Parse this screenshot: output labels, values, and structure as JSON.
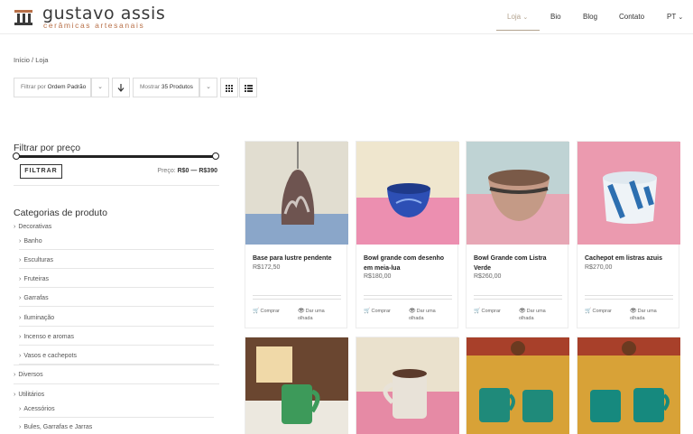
{
  "header": {
    "logo_title": "gustavo assis",
    "logo_subtitle": "cerâmicas artesanais",
    "nav": [
      {
        "label": "Loja",
        "active": true
      },
      {
        "label": "Bio"
      },
      {
        "label": "Blog"
      },
      {
        "label": "Contato"
      },
      {
        "label": "PT"
      }
    ],
    "nav_chevron": "⌄"
  },
  "breadcrumb": {
    "home": "Início",
    "separator": "/",
    "current": "Loja"
  },
  "toolbar": {
    "sort_prefix": "Filtrar por",
    "sort_value": "Ordem Padrão",
    "show_prefix": "Mostrar",
    "show_value": "35 Produtos"
  },
  "sidebar": {
    "price_heading": "Filtrar por preço",
    "filter_button": "FILTRAR",
    "price_label": "Preço:",
    "price_min": "R$0",
    "price_dash": "—",
    "price_max": "R$390",
    "categories_heading": "Categorias de produto",
    "categories": [
      {
        "label": "Decorativas",
        "level": 0
      },
      {
        "label": "Banho",
        "level": 1
      },
      {
        "label": "Esculturas",
        "level": 1
      },
      {
        "label": "Fruteiras",
        "level": 1
      },
      {
        "label": "Garrafas",
        "level": 1
      },
      {
        "label": "Iluminação",
        "level": 1
      },
      {
        "label": "Incenso e aromas",
        "level": 1
      },
      {
        "label": "Vasos e cachepots",
        "level": 1
      },
      {
        "label": "Diversos",
        "level": 0
      },
      {
        "label": "Utilitários",
        "level": 0
      },
      {
        "label": "Acessórios",
        "level": 1
      },
      {
        "label": "Bules, Garrafas e Jarras",
        "level": 1
      }
    ]
  },
  "products": [
    {
      "name": "Base para lustre pendente",
      "price": "R$172,50",
      "buy": "Comprar",
      "view": "Dar uma olhada",
      "bg": "#d9d4c4"
    },
    {
      "name": "Bowl grande com desenho em meia-lua",
      "price": "R$180,00",
      "buy": "Comprar",
      "view": "Dar uma olhada",
      "bg": "#e8c0cc"
    },
    {
      "name": "Bowl Grande com Listra Verde",
      "price": "R$260,00",
      "buy": "Comprar",
      "view": "Dar uma olhada",
      "bg": "#c7d6cf"
    },
    {
      "name": "Cachepot em listras azuis",
      "price": "R$270,00",
      "buy": "Comprar",
      "view": "Dar uma olhada",
      "bg": "#e79aae"
    },
    {
      "name": "",
      "price": "",
      "bg": "#6d4a32"
    },
    {
      "name": "",
      "price": "",
      "bg": "#d9a7a5"
    },
    {
      "name": "",
      "price": "",
      "bg": "#d59d3d"
    },
    {
      "name": "",
      "price": "",
      "bg": "#d59d3d"
    }
  ],
  "colors": {
    "accent": "#b3a38f",
    "logo_sub": "#b87048"
  }
}
